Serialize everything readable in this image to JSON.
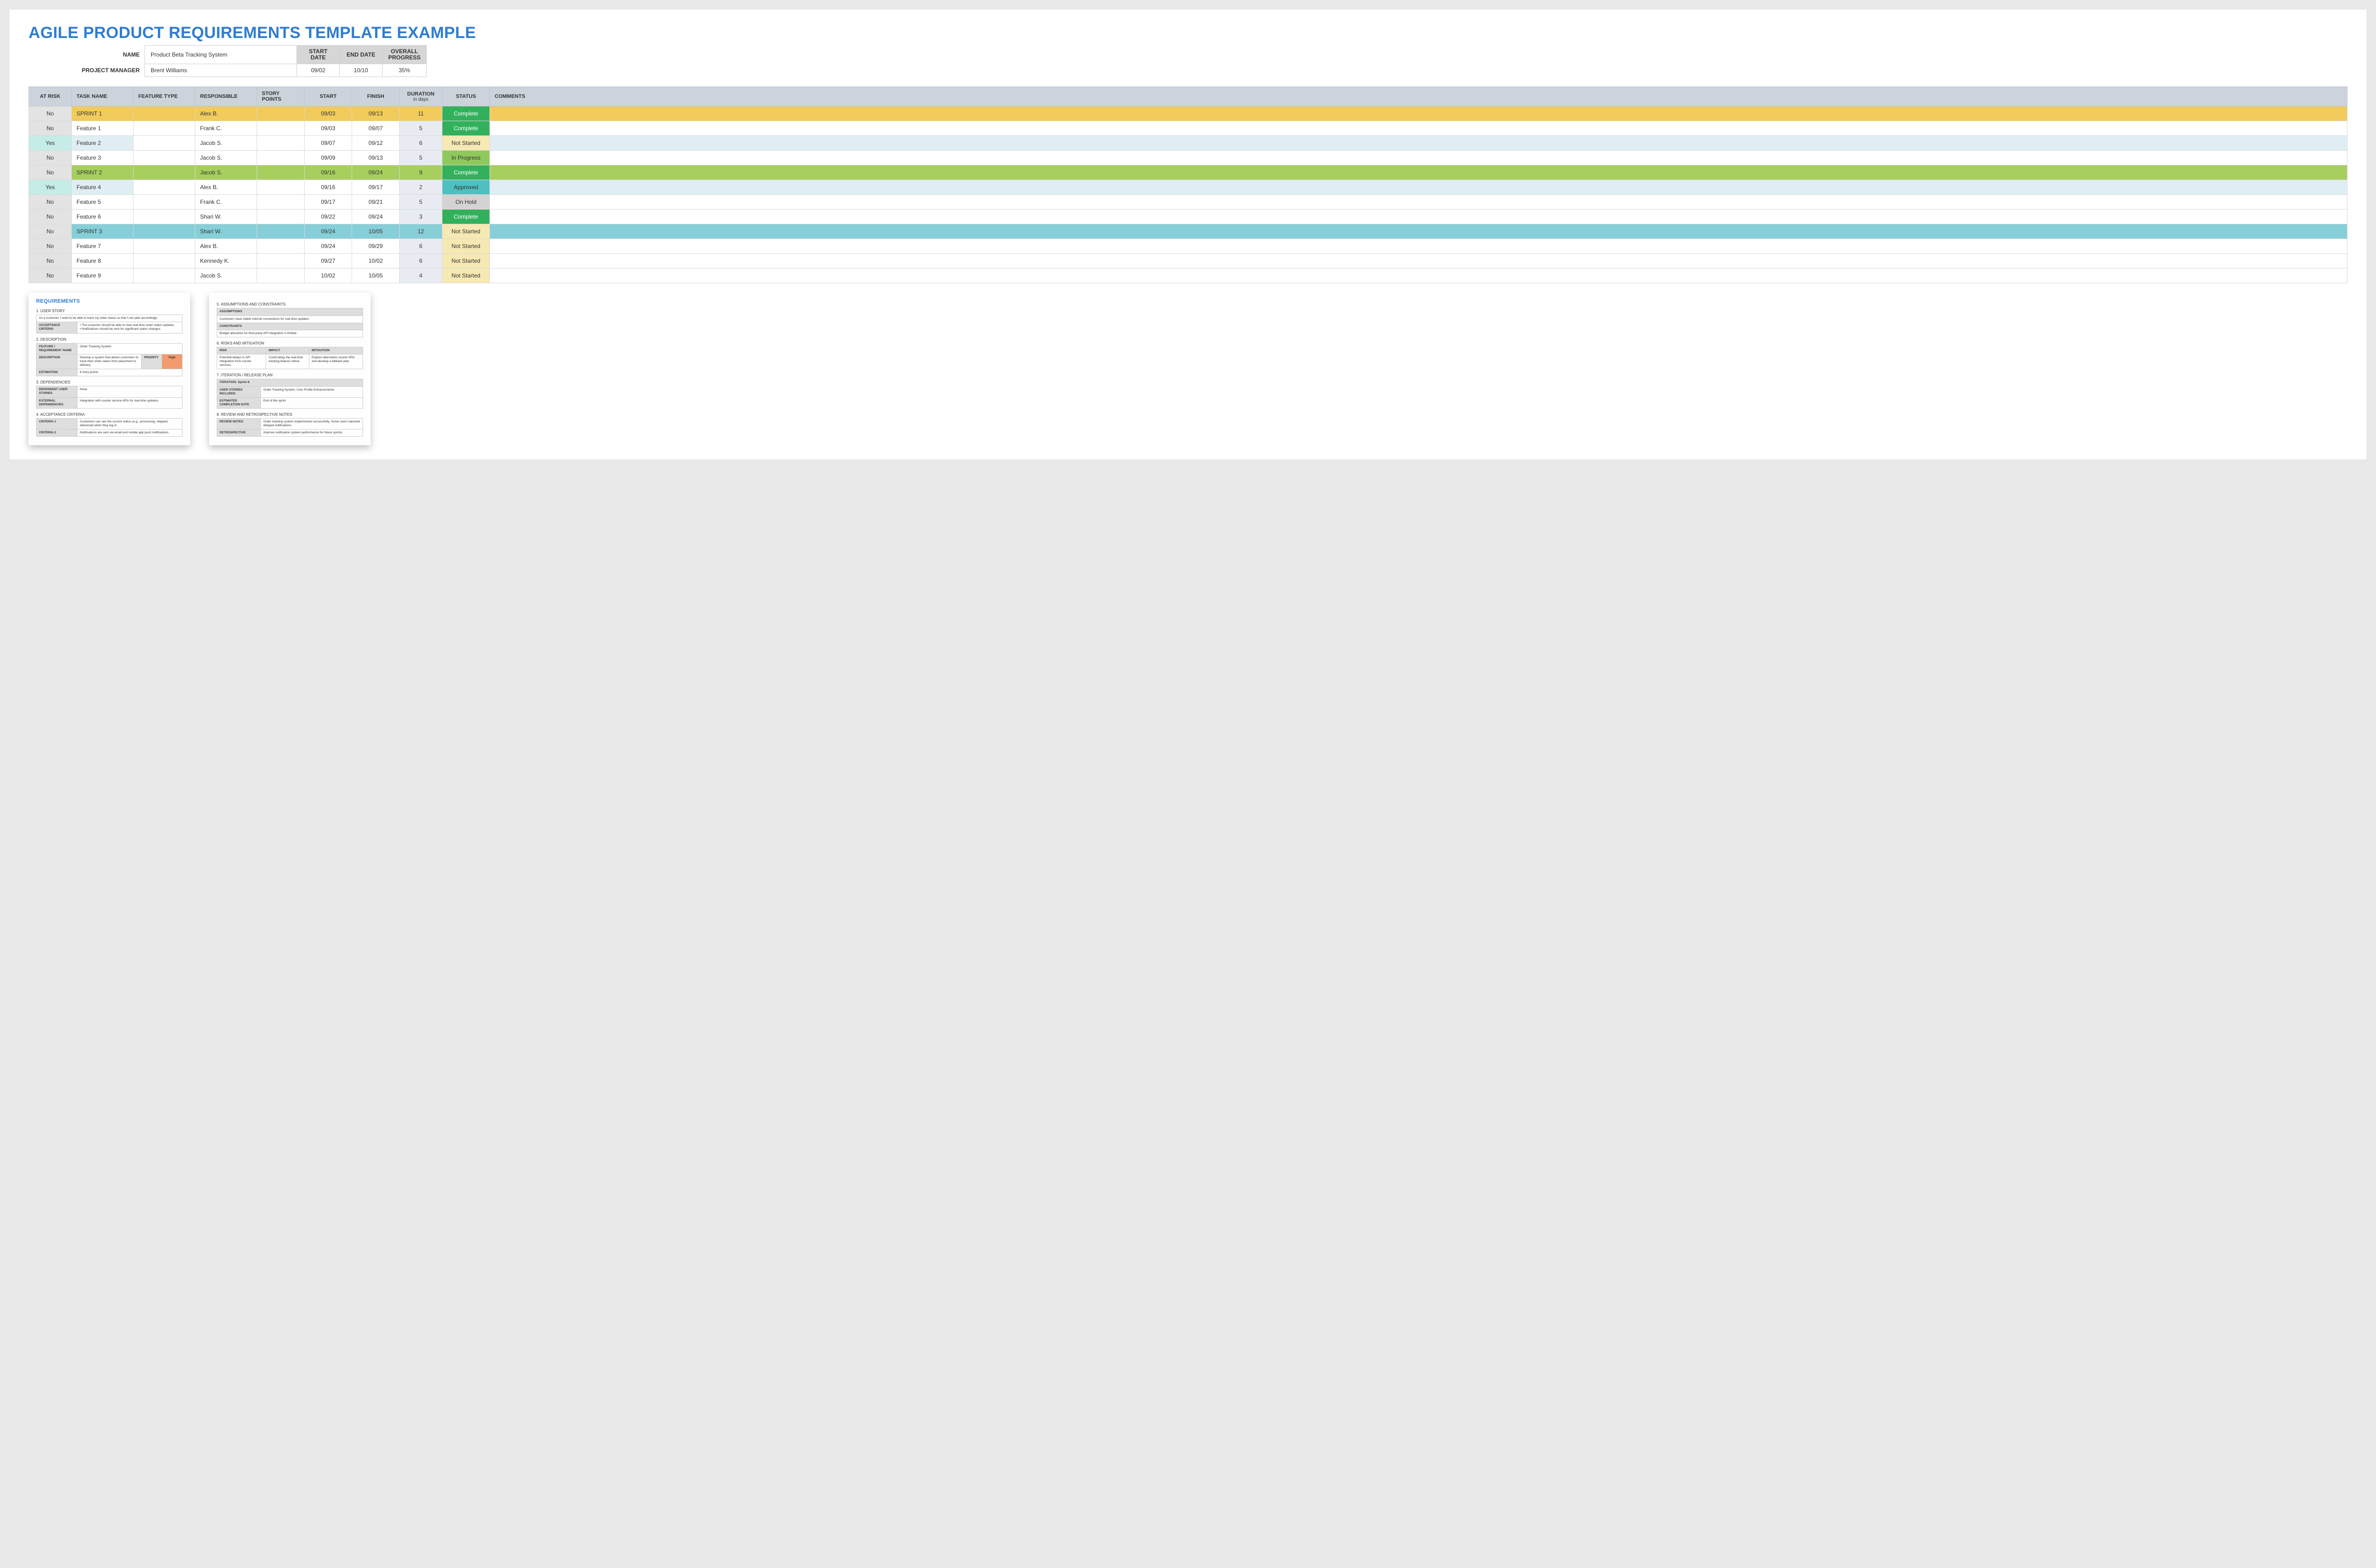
{
  "title": "AGILE PRODUCT REQUIREMENTS TEMPLATE EXAMPLE",
  "summary": {
    "name_label": "NAME",
    "name": "Product Beta Tracking System",
    "pm_label": "PROJECT MANAGER",
    "pm": "Brent Williams",
    "start_label": "START DATE",
    "end_label": "END DATE",
    "overall_label": "OVERALL PROGRESS",
    "start": "09/02",
    "end": "10/10",
    "progress": "35%"
  },
  "columns": {
    "risk": "AT RISK",
    "task": "TASK NAME",
    "feature": "FEATURE TYPE",
    "responsible": "RESPONSIBLE",
    "story": "STORY POINTS",
    "start": "START",
    "finish": "FINISH",
    "duration": "DURATION",
    "duration_sub": "in days",
    "status": "STATUS",
    "comments": "COMMENTS"
  },
  "rows": [
    {
      "risk": "No",
      "task": "SPRINT 1",
      "feature": "",
      "resp": "Alex B.",
      "story": "",
      "start": "09/03",
      "finish": "09/13",
      "dur": "11",
      "status": "Complete",
      "status_cls": "s-complete",
      "tint": "tint-yellow",
      "sprint": true
    },
    {
      "risk": "No",
      "task": "Feature 1",
      "feature": "",
      "resp": "Frank C.",
      "story": "",
      "start": "09/03",
      "finish": "09/07",
      "dur": "5",
      "status": "Complete",
      "status_cls": "s-complete"
    },
    {
      "risk": "Yes",
      "task": "Feature 2",
      "feature": "",
      "resp": "Jacob S.",
      "story": "",
      "start": "09/07",
      "finish": "09/12",
      "dur": "6",
      "status": "Not Started",
      "status_cls": "s-notstarted",
      "tint": "tint-paleblue"
    },
    {
      "risk": "No",
      "task": "Feature 3",
      "feature": "",
      "resp": "Jacob S.",
      "story": "",
      "start": "09/09",
      "finish": "09/13",
      "dur": "5",
      "status": "In Progress",
      "status_cls": "s-inprogress"
    },
    {
      "risk": "No",
      "task": "SPRINT 2",
      "feature": "",
      "resp": "Jacob S.",
      "story": "",
      "start": "09/16",
      "finish": "09/24",
      "dur": "9",
      "status": "Complete",
      "status_cls": "s-complete",
      "tint": "tint-green",
      "sprint": true
    },
    {
      "risk": "Yes",
      "task": "Feature 4",
      "feature": "",
      "resp": "Alex B.",
      "story": "",
      "start": "09/16",
      "finish": "09/17",
      "dur": "2",
      "status": "Approved",
      "status_cls": "s-approved",
      "tint": "tint-paleblue"
    },
    {
      "risk": "No",
      "task": "Feature 5",
      "feature": "",
      "resp": "Frank C.",
      "story": "",
      "start": "09/17",
      "finish": "09/21",
      "dur": "5",
      "status": "On Hold",
      "status_cls": "s-onhold"
    },
    {
      "risk": "No",
      "task": "Feature 6",
      "feature": "",
      "resp": "Shari W.",
      "story": "",
      "start": "09/22",
      "finish": "09/24",
      "dur": "3",
      "status": "Complete",
      "status_cls": "s-complete"
    },
    {
      "risk": "No",
      "task": "SPRINT 3",
      "feature": "",
      "resp": "Shari W.",
      "story": "",
      "start": "09/24",
      "finish": "10/05",
      "dur": "12",
      "status": "Not Started",
      "status_cls": "s-notstarted",
      "tint": "tint-blue",
      "sprint": true
    },
    {
      "risk": "No",
      "task": "Feature 7",
      "feature": "",
      "resp": "Alex B.",
      "story": "",
      "start": "09/24",
      "finish": "09/29",
      "dur": "6",
      "status": "Not Started",
      "status_cls": "s-notstarted"
    },
    {
      "risk": "No",
      "task": "Feature 8",
      "feature": "",
      "resp": "Kennedy K.",
      "story": "",
      "start": "09/27",
      "finish": "10/02",
      "dur": "6",
      "status": "Not Started",
      "status_cls": "s-notstarted"
    },
    {
      "risk": "No",
      "task": "Feature 9",
      "feature": "",
      "resp": "Jacob S.",
      "story": "",
      "start": "10/02",
      "finish": "10/05",
      "dur": "4",
      "status": "Not Started",
      "status_cls": "s-notstarted"
    }
  ],
  "req": {
    "title": "REQUIREMENTS",
    "s1": "1. USER STORY",
    "story": "As a customer, I want to be able to track my order status so that I can plan accordingly.",
    "ac_label": "ACCEPTANCE CRITERIA",
    "ac_text": "• The customer should be able to view real-time order status updates.\n• Notifications should be sent for significant status changes.",
    "s2": "2. DESCRIPTION",
    "frn_label": "FEATURE / REQUIREMENT NAME",
    "frn": "Order Tracking System",
    "desc_label": "DESCRIPTION",
    "desc": "Develop a system that allows customers to track their order status from placement to delivery.",
    "priority_label": "PRIORITY",
    "priority": "High",
    "est_label": "ESTIMATION",
    "est": "8 story points",
    "s3": "3. DEPENDENCIES",
    "dep_us_label": "DEPENDENT USER STORIES",
    "dep_us": "None",
    "ext_label": "EXTERNAL DEPENDENCIES",
    "ext": "Integration with courier service APIs for real-time updates.",
    "s4": "4. ACCEPTANCE CRITERIA",
    "c1_label": "CRITERIA 1",
    "c1": "Customers can see the current status (e.g., processing, shipped, delivered) when they log in.",
    "c2_label": "CRITERIA 2",
    "c2": "Notifications are sent via email and mobile app push notifications."
  },
  "plan": {
    "s5": "5. ASSUMPTIONS AND CONSTRAINTS",
    "assumptions_label": "ASSUMPTIONS",
    "assumptions": "Customers have stable internet connections for real-time updates.",
    "constraints_label": "CONSTRAINTS",
    "constraints": "Budget allocation for third-party API integration is limited.",
    "s6": "6. RISKS AND MITIGATION",
    "risk_h": "RISK",
    "impact_h": "IMPACT",
    "mitig_h": "MITIGATION",
    "risk": "Potential delays in API integration from courier services.",
    "impact": "Could delay the real-time tracking feature rollout.",
    "mitig": "Explore alternative courier APIs and develop a fallback plan.",
    "s7": "7. ITERATION / RELEASE PLAN",
    "iter_label": "ITERATION: Sprint 8",
    "us_incl_label": "USER STORIES INCLUDED",
    "us_incl": "Order Tracking System, User Profile Enhancements",
    "ecd_label": "ESTIMATED COMPLETION DATE",
    "ecd": "End of the sprint",
    "s8": "8. REVIEW AND RETROSPECTIVE NOTES",
    "rev_label": "REVIEW NOTES",
    "rev": "Order tracking system implemented successfully. Some users reported delayed notifications.",
    "retro_label": "RETROSPECTIVE",
    "retro": "Improve notification system performance for future sprints."
  }
}
